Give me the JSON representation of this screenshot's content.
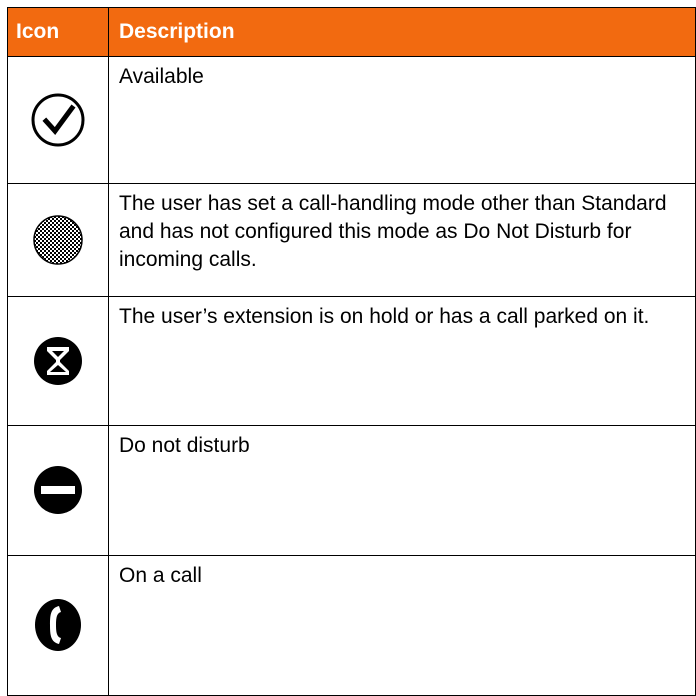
{
  "table": {
    "header": {
      "icon": "Icon",
      "description": "Description"
    },
    "rows": [
      {
        "icon": "check-circle-icon",
        "description": "Available"
      },
      {
        "icon": "checkered-circle-icon",
        "description": "The user has set a call-handling mode other than Standard and has not configured this mode as Do Not Disturb for incoming calls."
      },
      {
        "icon": "hourglass-circle-icon",
        "description": "The user’s extension is on hold or has a call parked on it."
      },
      {
        "icon": "no-entry-icon",
        "description": "Do not disturb"
      },
      {
        "icon": "phone-circle-icon",
        "description": "On a call"
      }
    ]
  },
  "colors": {
    "header_bg": "#f26a10",
    "header_text": "#ffffff",
    "border": "#000000"
  }
}
